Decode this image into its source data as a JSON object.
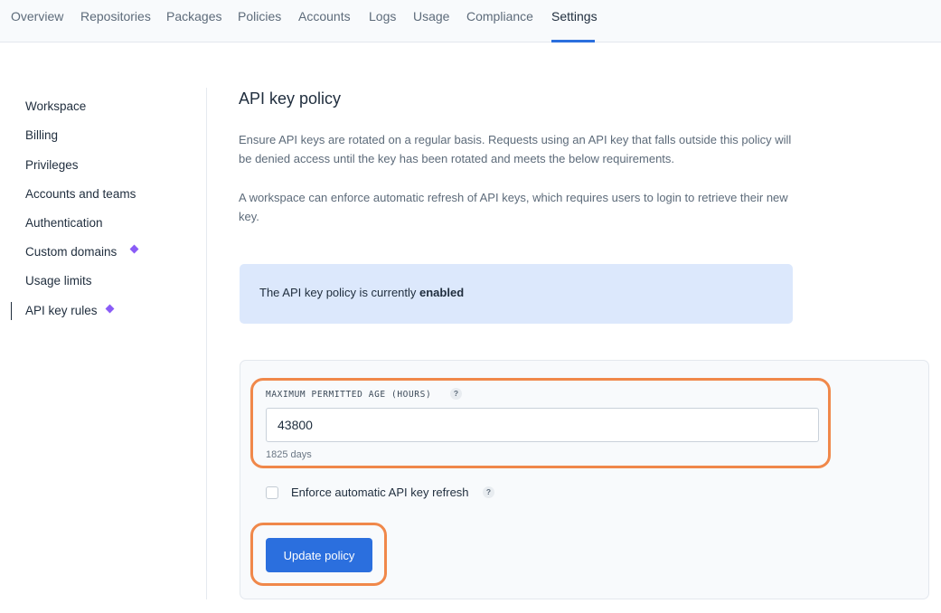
{
  "topnav": {
    "tabs": [
      {
        "label": "Overview"
      },
      {
        "label": "Repositories"
      },
      {
        "label": "Packages"
      },
      {
        "label": "Policies"
      },
      {
        "label": "Accounts"
      },
      {
        "label": "Logs"
      },
      {
        "label": "Usage"
      },
      {
        "label": "Compliance"
      },
      {
        "label": "Settings",
        "active": true
      }
    ]
  },
  "sidebar": {
    "items": [
      {
        "label": "Workspace"
      },
      {
        "label": "Billing"
      },
      {
        "label": "Privileges"
      },
      {
        "label": "Accounts and teams"
      },
      {
        "label": "Authentication"
      },
      {
        "label": "Custom domains",
        "badge": "diamond-icon"
      },
      {
        "label": "Usage limits"
      },
      {
        "label": "API key rules",
        "badge": "diamond-icon",
        "active": true
      }
    ]
  },
  "main": {
    "title": "API key policy",
    "description_1": "Ensure API keys are rotated on a regular basis. Requests using an API key that falls outside this policy will be denied access until the key has been rotated and meets the below requirements.",
    "description_2": "A workspace can enforce automatic refresh of API keys, which requires users to login to retrieve their new key.",
    "banner": {
      "prefix": "The API key policy is currently ",
      "status": "enabled"
    },
    "form": {
      "age_label": "MAXIMUM PERMITTED AGE (HOURS)",
      "help_glyph": "?",
      "age_value": "43800",
      "age_hint": "1825 days",
      "refresh_label": "Enforce automatic API key refresh",
      "refresh_checked": false,
      "submit_label": "Update policy"
    }
  },
  "colors": {
    "accent": "#2b6fde",
    "banner_bg": "#dce8fc",
    "highlight": "#f0884a",
    "badge": "#8a5cf6"
  }
}
